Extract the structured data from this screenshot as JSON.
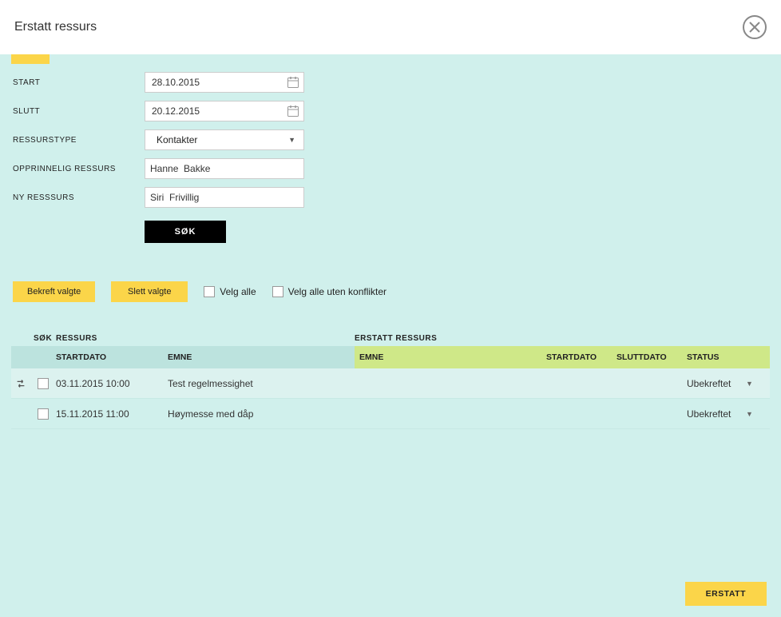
{
  "modal": {
    "title": "Erstatt ressurs"
  },
  "form": {
    "start": {
      "label": "START",
      "value": "28.10.2015"
    },
    "slutt": {
      "label": "SLUTT",
      "value": "20.12.2015"
    },
    "ressurstype": {
      "label": "RESSURSTYPE",
      "value": "Kontakter"
    },
    "opprinnelig": {
      "label": "OPPRINNELIG RESSURS",
      "value": "Hanne  Bakke"
    },
    "ny": {
      "label": "NY RESSSURS",
      "value": "Siri  Frivillig"
    },
    "search_btn": "SØK"
  },
  "actions": {
    "bekreft": "Bekreft valgte",
    "slett": "Slett valgte",
    "velg_alle": "Velg alle",
    "velg_alle_uten": "Velg alle uten konflikter"
  },
  "table": {
    "superheader": {
      "sok": "SØK",
      "ressurs": "RESSURS",
      "erstatt": "ERSTATT RESSURS"
    },
    "headers": {
      "startdato": "STARTDATO",
      "emne": "EMNE",
      "emne2": "EMNE",
      "startdato2": "STARTDATO",
      "sluttdato": "SLUTTDATO",
      "status": "STATUS"
    },
    "rows": [
      {
        "startdato": "03.11.2015 10:00",
        "emne": "Test regelmessighet",
        "status": "Ubekreftet",
        "selected": true
      },
      {
        "startdato": "15.11.2015 11:00",
        "emne": "Høymesse med dåp",
        "status": "Ubekreftet",
        "selected": false
      }
    ]
  },
  "footer": {
    "replace_btn": "ERSTATT"
  }
}
